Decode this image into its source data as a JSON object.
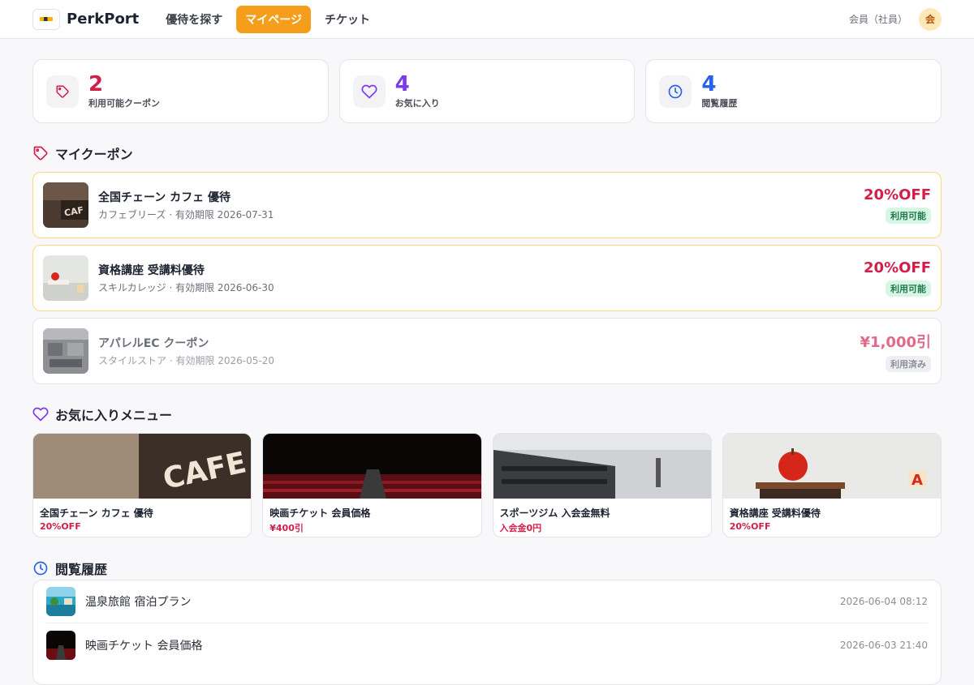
{
  "header": {
    "brand": "PerkPort",
    "nav": [
      "優待を探す",
      "マイページ",
      "チケット"
    ],
    "active_nav": "マイページ",
    "user_label": "会員（社員）",
    "avatar_text": "会"
  },
  "stats": [
    {
      "value": "2",
      "label": "利用可能クーポン",
      "color": "#d21f4a",
      "icon": "tag-icon"
    },
    {
      "value": "4",
      "label": "お気に入り",
      "color": "#7c3aed",
      "icon": "heart-icon"
    },
    {
      "value": "4",
      "label": "閲覧履歴",
      "color": "#2563eb",
      "icon": "clock-icon"
    }
  ],
  "sections": {
    "coupons_title": "マイクーポン",
    "favorites_title": "お気に入りメニュー",
    "history_title": "閲覧履歴"
  },
  "coupons": [
    {
      "title": "全国チェーン カフェ 優待",
      "sub": "カフェブリーズ · 有効期限 2026-07-31",
      "discount": "20%OFF",
      "status": "利用可能"
    },
    {
      "title": "資格講座 受講料優待",
      "sub": "スキルカレッジ · 有効期限 2026-06-30",
      "discount": "20%OFF",
      "status": "利用可能"
    },
    {
      "title": "アパレルEC クーポン",
      "sub": "スタイルストア · 有効期限 2026-05-20",
      "discount": "¥1,000引",
      "status": "利用済み"
    }
  ],
  "favorites": [
    {
      "title": "全国チェーン カフェ 優待",
      "price": "20%OFF"
    },
    {
      "title": "映画チケット 会員価格",
      "price": "¥400引"
    },
    {
      "title": "スポーツジム 入会金無料",
      "price": "入会金0円"
    },
    {
      "title": "資格講座 受講料優待",
      "price": "20%OFF"
    }
  ],
  "history": [
    {
      "title": "温泉旅館 宿泊プラン",
      "time": "2026-06-04 08:12"
    },
    {
      "title": "映画チケット 会員価格",
      "time": "2026-06-03 21:40"
    }
  ]
}
